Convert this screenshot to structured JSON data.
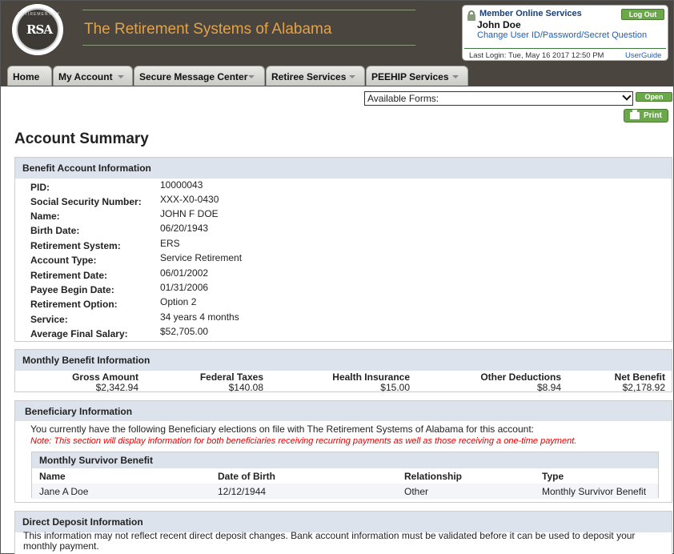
{
  "header": {
    "logo_text": "RSA",
    "logo_ring": "RETIREMENT SYSTEMS OF ALABAMA",
    "site_title": "The Retirement Systems of Alabama"
  },
  "member_box": {
    "title": "Member Online Services",
    "logout_label": "Log Out",
    "user_name": "John Doe",
    "change_link": "Change User ID/Password/Secret Question",
    "last_login": "Last Login: Tue, May 16 2017 12:50 PM",
    "user_guide": "UserGuide"
  },
  "nav": {
    "tabs": [
      {
        "label": "Home"
      },
      {
        "label": "My Account"
      },
      {
        "label": "Secure Message Center"
      },
      {
        "label": "Retiree Services"
      },
      {
        "label": "PEEHIP Services"
      }
    ]
  },
  "forms": {
    "select_value": "Available Forms:",
    "open_label": "Open",
    "print_label": "Print"
  },
  "page": {
    "title": "Account Summary"
  },
  "benefit_account": {
    "heading": "Benefit Account Information",
    "fields": [
      {
        "label": "PID:",
        "value": "10000043"
      },
      {
        "label": "Social Security Number:",
        "value": "XXX-X0-0430"
      },
      {
        "label": "Name:",
        "value": "JOHN F DOE"
      },
      {
        "label": "Birth Date:",
        "value": "06/20/1943"
      },
      {
        "label": "Retirement System:",
        "value": "ERS"
      },
      {
        "label": "Account Type:",
        "value": "Service Retirement"
      },
      {
        "label": "Retirement Date:",
        "value": "06/01/2002"
      },
      {
        "label": "Payee Begin Date:",
        "value": "01/31/2006"
      },
      {
        "label": "Retirement Option:",
        "value": "Option 2"
      },
      {
        "label": "Service:",
        "value": "34 years 4 months"
      },
      {
        "label": "Average Final Salary:",
        "value": "$52,705.00"
      }
    ]
  },
  "monthly_benefit": {
    "heading": "Monthly Benefit Information",
    "columns": [
      {
        "label": "Gross Amount",
        "value": "$2,342.94"
      },
      {
        "label": "Federal Taxes",
        "value": "$140.08"
      },
      {
        "label": "Health Insurance",
        "value": "$15.00"
      },
      {
        "label": "Other Deductions",
        "value": "$8.94"
      },
      {
        "label": "Net Benefit",
        "value": "$2,178.92"
      }
    ]
  },
  "beneficiary": {
    "heading": "Beneficiary Information",
    "intro": "You currently have the following Beneficiary elections on file with The Retirement Systems of Alabama for this account:",
    "note": "Note: This section will display information for both beneficiaries receiving recurring payments as well as those receiving a one-time payment.",
    "table_title": "Monthly Survivor Benefit",
    "headers": [
      "Name",
      "Date of Birth",
      "Relationship",
      "Type"
    ],
    "rows": [
      [
        "Jane A Doe",
        "12/12/1944",
        "Other",
        "Monthly Survivor Benefit"
      ]
    ]
  },
  "direct_deposit": {
    "heading": "Direct Deposit Information",
    "text": "This information may not reflect recent direct deposit changes. Bank account information must be validated before it can be used to deposit your monthly payment."
  },
  "colors": {
    "header_bg": "#4a453e",
    "title_orange": "#e1a34a",
    "button_green": "#6ba84a",
    "section_head": "#dde3ec",
    "link_blue": "#1a5fb4",
    "note_red": "#e00000"
  }
}
